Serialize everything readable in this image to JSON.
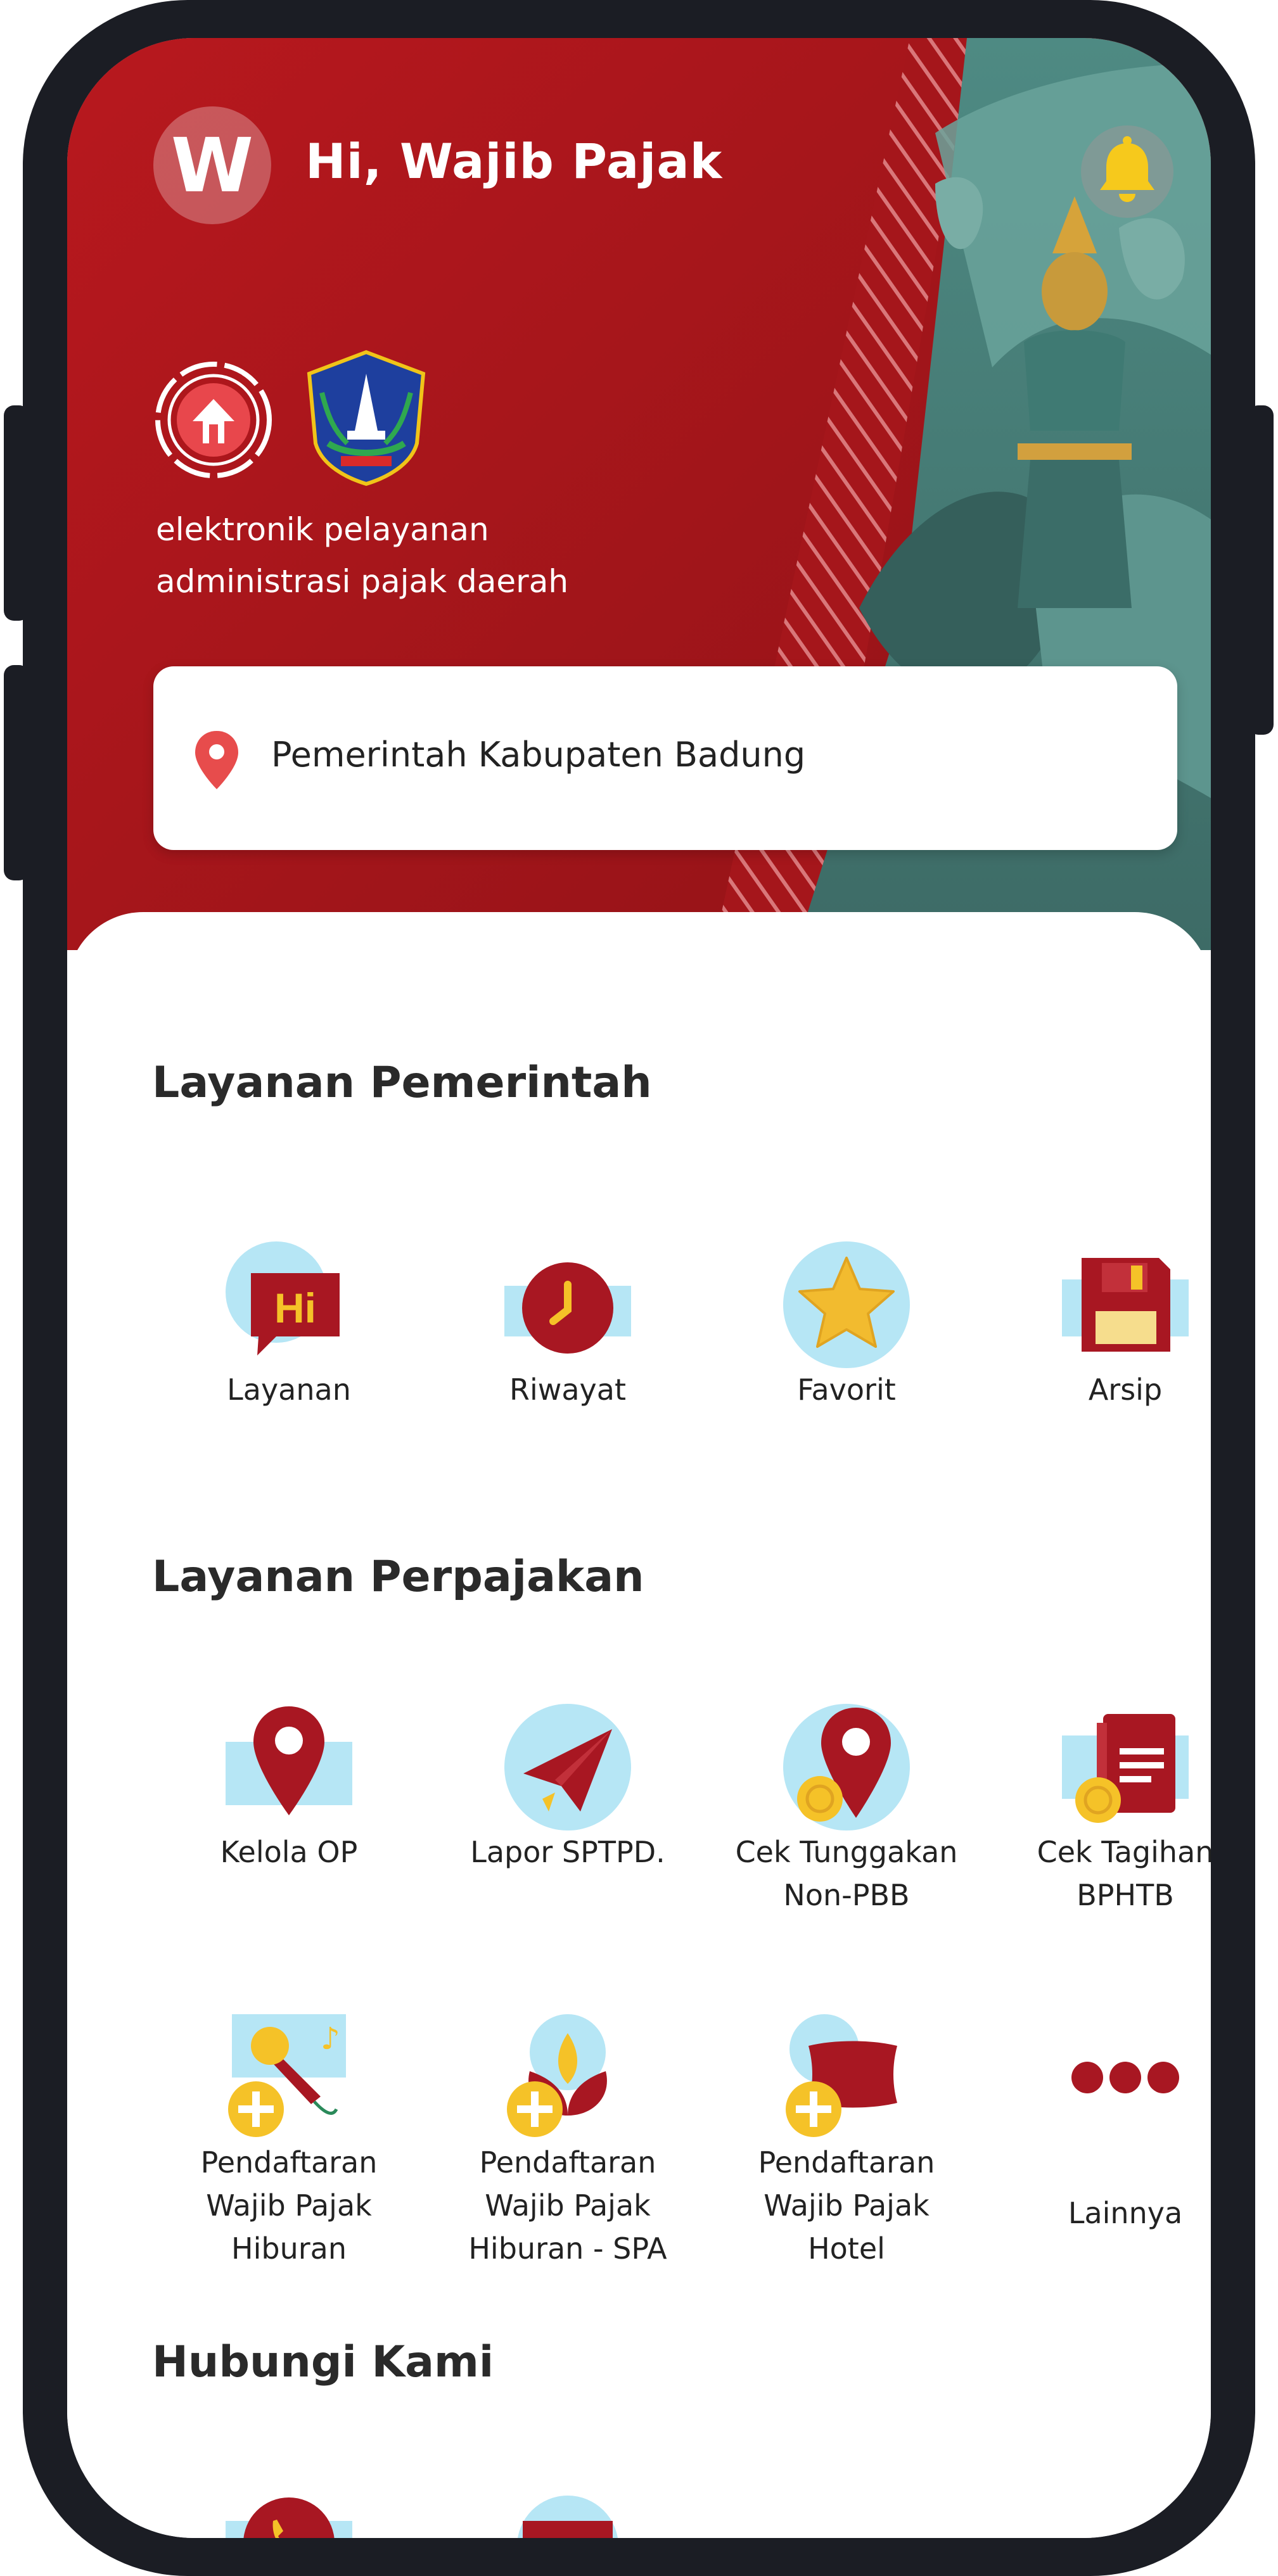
{
  "header": {
    "avatar_letter": "W",
    "greeting": "Hi, Wajib Pajak",
    "tagline": [
      "elektronik pelayanan",
      "administrasi pajak daerah"
    ],
    "location": "Pemerintah Kabupaten Badung"
  },
  "sections": {
    "pemerintah": {
      "title": "Layanan Pemerintah",
      "items": [
        {
          "label": [
            "Layanan"
          ],
          "icon": "hi-chat-icon"
        },
        {
          "label": [
            "Riwayat"
          ],
          "icon": "clock-icon"
        },
        {
          "label": [
            "Favorit"
          ],
          "icon": "star-icon"
        },
        {
          "label": [
            "Arsip"
          ],
          "icon": "floppy-disk-icon"
        }
      ]
    },
    "perpajakan": {
      "title": "Layanan Perpajakan",
      "items": [
        {
          "label": [
            "Kelola OP"
          ],
          "icon": "map-pin-icon"
        },
        {
          "label": [
            "Lapor SPTPD."
          ],
          "icon": "paper-plane-icon"
        },
        {
          "label": [
            "Cek Tunggakan",
            "Non-PBB"
          ],
          "icon": "pin-coin-icon"
        },
        {
          "label": [
            "Cek Tagihan",
            "BPHTB"
          ],
          "icon": "document-coin-icon"
        },
        {
          "label": [
            "Pendaftaran",
            "Wajib Pajak",
            "Hiburan"
          ],
          "icon": "microphone-plus-icon"
        },
        {
          "label": [
            "Pendaftaran",
            "Wajib Pajak",
            "Hiburan - SPA"
          ],
          "icon": "lotus-plus-icon"
        },
        {
          "label": [
            "Pendaftaran",
            "Wajib Pajak",
            "Hotel"
          ],
          "icon": "pillow-plus-icon"
        },
        {
          "label": [
            "Lainnya"
          ],
          "icon": "more-dots-icon"
        }
      ]
    },
    "hubungi": {
      "title": "Hubungi Kami",
      "items": [
        {
          "icon": "phone-icon"
        },
        {
          "icon": "email-icon"
        }
      ]
    }
  },
  "colors": {
    "brand_red": "#a5161b",
    "icon_red": "#a81722",
    "icon_blue": "#b6e6f5",
    "icon_yellow": "#f5c228"
  }
}
